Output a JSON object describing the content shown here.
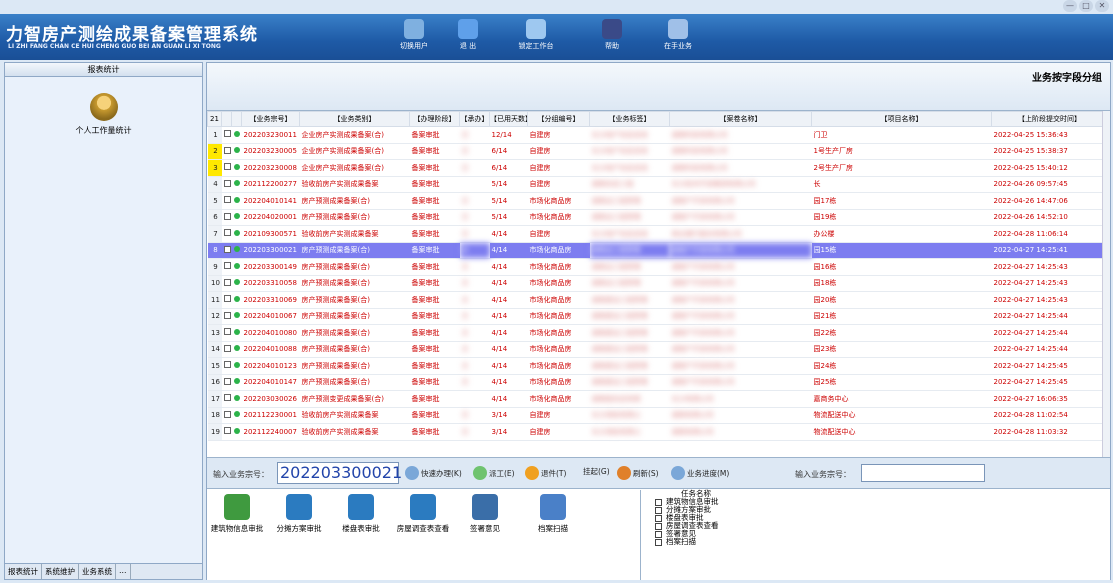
{
  "window_controls": [
    "—",
    "□",
    "✕"
  ],
  "app": {
    "title": "力智房产测绘成果备案管理系统",
    "subtitle": "LI ZHI FANG CHAN CE HUI CHENG GUO BEI AN GUAN LI XI TONG"
  },
  "toolbar": [
    {
      "label": "切换用户",
      "icon": "switch-user-icon",
      "color": "#7fb0e0"
    },
    {
      "label": "退 出",
      "icon": "exit-icon",
      "color": "#5fa0ea"
    },
    {
      "label": "锁定工作台",
      "icon": "lock-desk-icon",
      "color": "#9ec8f0"
    },
    {
      "label": "帮助",
      "icon": "help-icon",
      "color": "#3a4a88"
    },
    {
      "label": "在手业务",
      "icon": "pending-tasks-icon",
      "color": "#a0c0e8"
    }
  ],
  "sidebar": {
    "header": "报表统计",
    "item": "个人工作量统计",
    "tabs": [
      "报表统计",
      "系统维护",
      "业务系统",
      "…"
    ]
  },
  "main": {
    "group_title": "业务按字段分组",
    "columns": [
      "21",
      "",
      "",
      "【业务宗号】",
      "【业务类别】",
      "【办理阶段】",
      "【承办】",
      "【已用天数】",
      "【分组编号】",
      "【业务标签】",
      "【案卷名称】",
      "【项目名称】",
      "【上阶段提交时间】"
    ],
    "rows": [
      {
        "n": "1",
        "no": "202203230011",
        "type": "企业房产实测成果备案(合)",
        "stage": "备案审批",
        "who": "日",
        "days": "12/14",
        "group": "自建房",
        "tag": "长沙地产信息咨询",
        "file": "湖南科技有限公司",
        "proj": "门卫",
        "time": "2022-04-25 15:36:43",
        "hl": ""
      },
      {
        "n": "2",
        "no": "202203230005",
        "type": "企业房产实测成果备案(合)",
        "stage": "备案审批",
        "who": "日",
        "days": "6/14",
        "group": "自建房",
        "tag": "长沙地产信息咨询",
        "file": "湖南科技有限公司",
        "proj": "1号生产厂房",
        "time": "2022-04-25 15:38:37",
        "hl": "yellow"
      },
      {
        "n": "3",
        "no": "202203230008",
        "type": "企业房产实测成果备案(合)",
        "stage": "备案审批",
        "who": "日",
        "days": "6/14",
        "group": "自建房",
        "tag": "长沙地产信息咨询",
        "file": "湖南科技有限公司",
        "proj": "2号生产厂房",
        "time": "2022-04-25 15:40:12",
        "hl": "yellow"
      },
      {
        "n": "4",
        "no": "202112200277",
        "type": "验收前房产实测成果备案",
        "stage": "备案审批",
        "who": "",
        "days": "5/14",
        "group": "自建房",
        "tag": "湖南信息工程",
        "file": "长沙技术开发集团有限公司",
        "proj": "长",
        "time": "2022-04-26 09:57:45",
        "hl": ""
      },
      {
        "n": "5",
        "no": "202204010141",
        "type": "房产预测成果备案(合)",
        "stage": "备案审批",
        "who": "日",
        "days": "5/14",
        "group": "市场化商品房",
        "tag": "湖南设工程管理",
        "file": "湖南产开发有限公司",
        "proj": "园17栋",
        "time": "2022-04-26 14:47:06",
        "hl": ""
      },
      {
        "n": "6",
        "no": "202204020001",
        "type": "房产预测成果备案(合)",
        "stage": "备案审批",
        "who": "日",
        "days": "5/14",
        "group": "市场化商品房",
        "tag": "湖南设工程管理",
        "file": "湖南产开发有限公司",
        "proj": "园19栋",
        "time": "2022-04-26 14:52:10",
        "hl": ""
      },
      {
        "n": "7",
        "no": "202109300571",
        "type": "验收前房产实测成果备案",
        "stage": "备案审批",
        "who": "日",
        "days": "4/14",
        "group": "自建房",
        "tag": "长沙地产信息咨询",
        "file": "商业银行股份有限公司",
        "proj": "办公楼",
        "time": "2022-04-28 11:06:14",
        "hl": ""
      },
      {
        "n": "8",
        "no": "202203300021",
        "type": "房产预测成果备案(合)",
        "stage": "备案审批",
        "who": "文",
        "days": "4/14",
        "group": "市场化商品房",
        "tag": "湖南设工程管理",
        "file": "湖南产开发有限公司",
        "proj": "园15栋",
        "time": "2022-04-27 14:25:41",
        "hl": "sel"
      },
      {
        "n": "9",
        "no": "202203300149",
        "type": "房产预测成果备案(合)",
        "stage": "备案审批",
        "who": "文",
        "days": "4/14",
        "group": "市场化商品房",
        "tag": "湖南设工程管理",
        "file": "湖南产开发有限公司",
        "proj": "园16栋",
        "time": "2022-04-27 14:25:43",
        "hl": ""
      },
      {
        "n": "10",
        "no": "202203310058",
        "type": "房产预测成果备案(合)",
        "stage": "备案审批",
        "who": "文",
        "days": "4/14",
        "group": "市场化商品房",
        "tag": "湖南设工程管理",
        "file": "湖南产开发有限公司",
        "proj": "园18栋",
        "time": "2022-04-27 14:25:43",
        "hl": ""
      },
      {
        "n": "11",
        "no": "202203310069",
        "type": "房产预测成果备案(合)",
        "stage": "备案审批",
        "who": "文",
        "days": "4/14",
        "group": "市场化商品房",
        "tag": "湖南建设工程管理",
        "file": "湖南产开发有限公司",
        "proj": "园20栋",
        "time": "2022-04-27 14:25:43",
        "hl": ""
      },
      {
        "n": "12",
        "no": "202204010067",
        "type": "房产预测成果备案(合)",
        "stage": "备案审批",
        "who": "文",
        "days": "4/14",
        "group": "市场化商品房",
        "tag": "湖南建设工程管理",
        "file": "湖南产开发有限公司",
        "proj": "园21栋",
        "time": "2022-04-27 14:25:44",
        "hl": ""
      },
      {
        "n": "13",
        "no": "202204010080",
        "type": "房产预测成果备案(合)",
        "stage": "备案审批",
        "who": "文",
        "days": "4/14",
        "group": "市场化商品房",
        "tag": "湖南建设工程管理",
        "file": "湖南产开发有限公司",
        "proj": "园22栋",
        "time": "2022-04-27 14:25:44",
        "hl": ""
      },
      {
        "n": "14",
        "no": "202204010088",
        "type": "房产预测成果备案(合)",
        "stage": "备案审批",
        "who": "文",
        "days": "4/14",
        "group": "市场化商品房",
        "tag": "湖南建设工程管理",
        "file": "湖南产开发有限公司",
        "proj": "园23栋",
        "time": "2022-04-27 14:25:44",
        "hl": ""
      },
      {
        "n": "15",
        "no": "202204010123",
        "type": "房产预测成果备案(合)",
        "stage": "备案审批",
        "who": "文",
        "days": "4/14",
        "group": "市场化商品房",
        "tag": "湖南建设工程管理",
        "file": "湖南产开发有限公司",
        "proj": "园24栋",
        "time": "2022-04-27 14:25:45",
        "hl": ""
      },
      {
        "n": "16",
        "no": "202204010147",
        "type": "房产预测成果备案(合)",
        "stage": "备案审批",
        "who": "文",
        "days": "4/14",
        "group": "市场化商品房",
        "tag": "湖南建设工程管理",
        "file": "湖南产开发有限公司",
        "proj": "园25栋",
        "time": "2022-04-27 14:25:45",
        "hl": ""
      },
      {
        "n": "17",
        "no": "202203030026",
        "type": "房产预测变更成果备案(合)",
        "stage": "备案审批",
        "who": "",
        "days": "4/14",
        "group": "市场化商品房",
        "tag": "湖南程信息有限",
        "file": "长沙有限公司",
        "proj": "嘉商务中心",
        "time": "2022-04-27 16:06:35",
        "hl": ""
      },
      {
        "n": "18",
        "no": "202112230001",
        "type": "验收前房产实测成果备案",
        "stage": "备案审批",
        "who": "日",
        "days": "3/14",
        "group": "自建房",
        "tag": "长沙测绘有限公",
        "file": "湖南有限公司",
        "proj": "物流配送中心",
        "time": "2022-04-28 11:02:54",
        "hl": ""
      },
      {
        "n": "19",
        "no": "202112240007",
        "type": "验收前房产实测成果备案",
        "stage": "备案审批",
        "who": "日",
        "days": "3/14",
        "group": "自建房",
        "tag": "长沙测绘有限公",
        "file": "湖南有限公司",
        "proj": "物流配送中心",
        "time": "2022-04-28 11:03:32",
        "hl": ""
      }
    ]
  },
  "input_bar": {
    "label": "输入业务宗号：",
    "value": "202203300021",
    "quick": "快速办理(K)",
    "dispatch": "派工(E)",
    "return": "退件(T)",
    "hang": "挂起(G)",
    "refresh": "刷新(S)",
    "progress": "业务进度(M)",
    "label2": "输入业务宗号："
  },
  "bottom_buttons": [
    {
      "label": "建筑物信息审批",
      "icon": "globe-icon",
      "color": "#3f9a3f"
    },
    {
      "label": "分摊方案审批",
      "icon": "graduate-icon",
      "color": "#2b7bc0"
    },
    {
      "label": "楼盘表审批",
      "icon": "graduate-icon",
      "color": "#2b7bc0"
    },
    {
      "label": "房屋调查表查看",
      "icon": "graduate-icon",
      "color": "#2b7bc0"
    },
    {
      "label": "签署意见",
      "icon": "scanner-icon",
      "color": "#3a6ea8"
    },
    {
      "label": "档案扫描",
      "icon": "edit-icon",
      "color": "#4a80c8"
    }
  ],
  "tasklist": {
    "header": "任务名称",
    "items": [
      "建筑物信息审批",
      "分摊方案审批",
      "楼盘表审批",
      "房屋调查表查看",
      "签署意见",
      "档案扫描"
    ]
  }
}
